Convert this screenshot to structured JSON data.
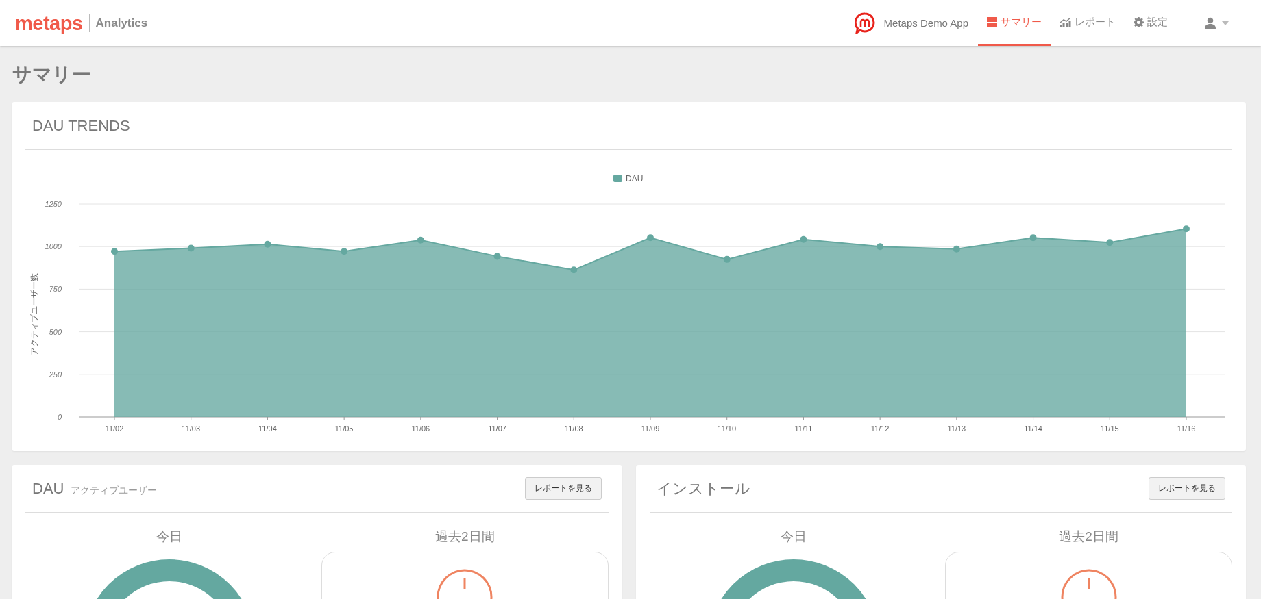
{
  "header": {
    "logo": "metaps",
    "product": "Analytics",
    "app_name": "Metaps Demo App",
    "nav": [
      {
        "label": "サマリー",
        "selected": true
      },
      {
        "label": "レポート",
        "selected": false
      },
      {
        "label": "設定",
        "selected": false
      }
    ]
  },
  "page_title": "サマリー",
  "trends": {
    "title": "DAU TRENDS",
    "chart_data": {
      "type": "area",
      "ylabel": "アクティブユーザー数",
      "categories": [
        "11/02",
        "11/03",
        "11/04",
        "11/05",
        "11/06",
        "11/07",
        "11/08",
        "11/09",
        "11/10",
        "11/11",
        "11/12",
        "11/13",
        "11/14",
        "11/15",
        "11/16"
      ],
      "series": [
        {
          "name": "DAU",
          "color": "#65a8a0",
          "values": [
            972,
            991,
            1014,
            972,
            1038,
            943,
            863,
            1052,
            925,
            1042,
            1000,
            986,
            1052,
            1024,
            1104
          ]
        }
      ],
      "ylim": [
        0,
        1250
      ],
      "grid": true,
      "yticks": [
        0,
        250,
        500,
        750,
        1000,
        1250
      ]
    }
  },
  "panels": [
    {
      "title": "DAU",
      "subtitle": "アクティブユーザー",
      "button": "レポートを見る",
      "today": "今日",
      "past": "過去2日間"
    },
    {
      "title": "インストール",
      "button": "レポートを見る",
      "today": "今日",
      "past": "過去2日間"
    }
  ]
}
